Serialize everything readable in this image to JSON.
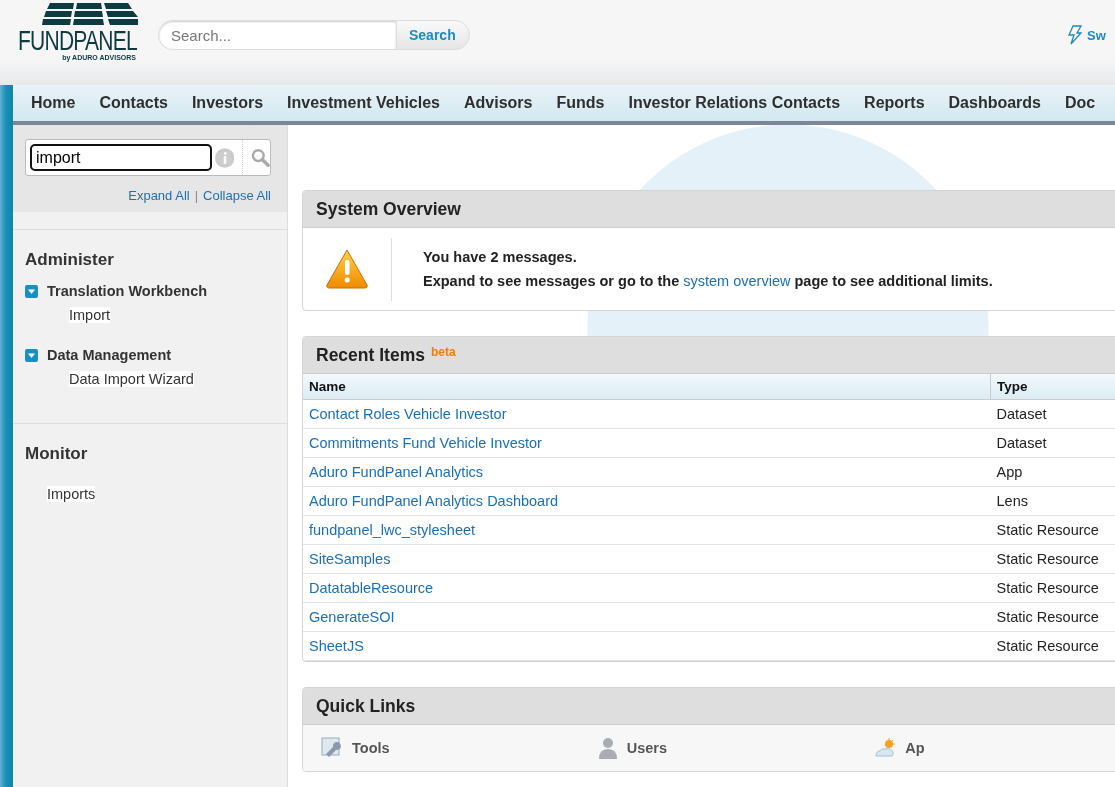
{
  "header": {
    "logo": {
      "name": "FUNDPANEL",
      "byline": "by ADURO ADVISORS"
    },
    "search": {
      "placeholder": "Search...",
      "button": "Search"
    },
    "switch_link": "Sw"
  },
  "nav": {
    "tabs": [
      {
        "label": "Home",
        "selected": false
      },
      {
        "label": "Contacts",
        "selected": false
      },
      {
        "label": "Investors",
        "selected": false
      },
      {
        "label": "Investment Vehicles",
        "selected": false
      },
      {
        "label": "Advisors",
        "selected": false
      },
      {
        "label": "Funds",
        "selected": false
      },
      {
        "label": "Investor Relations Contacts",
        "selected": false
      },
      {
        "label": "Reports",
        "selected": false
      },
      {
        "label": "Dashboards",
        "selected": false
      },
      {
        "label": "Doc",
        "selected": false
      }
    ]
  },
  "sidebar": {
    "search": {
      "value": "import"
    },
    "expand_all": "Expand All",
    "separator": "|",
    "collapse_all": "Collapse All",
    "sections": [
      {
        "title": "Administer",
        "items": [
          {
            "label": "Translation Workbench",
            "expanded": true,
            "children": [
              {
                "label": "Import"
              }
            ]
          },
          {
            "label": "Data Management",
            "expanded": true,
            "children": [
              {
                "label": "Data Import Wizard"
              }
            ]
          }
        ]
      },
      {
        "title": "Monitor",
        "items": [
          {
            "label": "Imports"
          }
        ]
      }
    ]
  },
  "system_overview": {
    "title": "System Overview",
    "line1": "You have 2 messages.",
    "line2_before": "Expand to see messages or go to the",
    "link": "system overview",
    "line2_after": "page to see additional limits."
  },
  "recent_items": {
    "title": "Recent Items",
    "badge": "beta",
    "columns": [
      "Name",
      "Type"
    ],
    "rows": [
      {
        "name": "Contact Roles Vehicle Investor",
        "type": "Dataset"
      },
      {
        "name": "Commitments Fund Vehicle Investor",
        "type": "Dataset"
      },
      {
        "name": "Aduro FundPanel Analytics",
        "type": "App"
      },
      {
        "name": "Aduro FundPanel Analytics Dashboard",
        "type": "Lens"
      },
      {
        "name": "fundpanel_lwc_stylesheet",
        "type": "Static Resource"
      },
      {
        "name": "SiteSamples",
        "type": "Static Resource"
      },
      {
        "name": "DatatableResource",
        "type": "Static Resource"
      },
      {
        "name": "GenerateSOI",
        "type": "Static Resource"
      },
      {
        "name": "SheetJS",
        "type": "Static Resource"
      }
    ]
  },
  "quick_links": {
    "title": "Quick Links",
    "columns": [
      {
        "kind": "tools",
        "label": "Tools"
      },
      {
        "kind": "users",
        "label": "Users"
      },
      {
        "kind": "apps",
        "label": "Ap"
      }
    ]
  }
}
